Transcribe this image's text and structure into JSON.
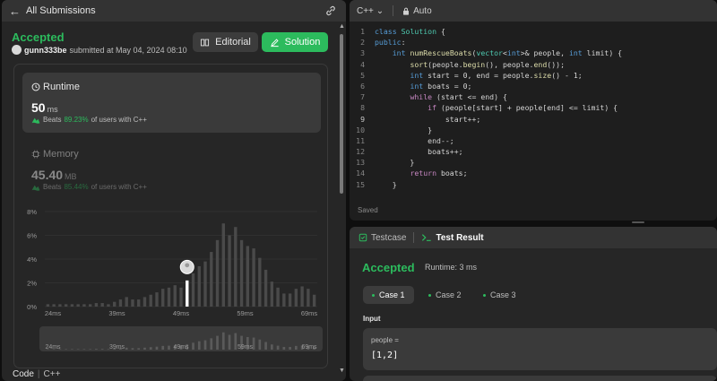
{
  "submission": {
    "back_label": "All Submissions",
    "status": "Accepted",
    "user": "gunn333be",
    "submitted_text": "submitted at May 04, 2024 08:10",
    "editorial_label": "Editorial",
    "solution_label": "Solution"
  },
  "runtime": {
    "title": "Runtime",
    "value": "50",
    "unit": "ms",
    "beats_prefix": "Beats",
    "beats_pct": "89.23%",
    "beats_suffix": "of users with C++"
  },
  "memory": {
    "title": "Memory",
    "value": "45.40",
    "unit": "MB",
    "beats_prefix": "Beats",
    "beats_pct": "85.44%",
    "beats_suffix": "of users with C++"
  },
  "chart_data": {
    "type": "bar",
    "yticks": [
      "8%",
      "6%",
      "4%",
      "2%",
      "0%"
    ],
    "ylim": [
      0,
      8
    ],
    "xticks": [
      "24ms",
      "39ms",
      "49ms",
      "59ms",
      "69ms"
    ],
    "mini_xticks": [
      "24ms",
      "39ms",
      "49ms",
      "59ms",
      "69ms"
    ],
    "values": [
      0.2,
      0.2,
      0.2,
      0.2,
      0.2,
      0.2,
      0.2,
      0.2,
      0.3,
      0.3,
      0.2,
      0.4,
      0.6,
      0.8,
      0.6,
      0.6,
      0.8,
      1.0,
      1.2,
      1.5,
      1.6,
      1.8,
      1.6,
      2.2,
      2.8,
      3.4,
      3.8,
      4.6,
      5.6,
      7.0,
      6.0,
      6.7,
      5.6,
      5.1,
      4.9,
      4.1,
      3.1,
      2.1,
      1.6,
      1.1,
      1.1,
      1.5,
      1.7,
      1.5,
      1.0
    ],
    "highlight_index": 23
  },
  "footer": {
    "code_label": "Code",
    "language": "C++"
  },
  "editor": {
    "language": "C++",
    "mode": "Auto",
    "saved_label": "Saved",
    "lines": [
      "1",
      "2",
      "3",
      "4",
      "5",
      "6",
      "7",
      "8",
      "9",
      "10",
      "11",
      "12",
      "13",
      "14",
      "15"
    ]
  },
  "result": {
    "testcase_tab": "Testcase",
    "result_tab": "Test Result",
    "status": "Accepted",
    "runtime_text": "Runtime: 3 ms",
    "cases": [
      "Case 1",
      "Case 2",
      "Case 3"
    ],
    "input_label": "Input",
    "param_name": "people =",
    "param_value": "[1,2]"
  },
  "colors": {
    "accent": "#2cbb5d",
    "panel": "#262626",
    "editor_bg": "#1e1e1e"
  },
  "icons": [
    "arrow-left-icon",
    "link-icon",
    "book-icon",
    "edit-icon",
    "clock-icon",
    "chip-icon",
    "leaf-icon",
    "lock-icon",
    "check-box-icon",
    "terminal-icon"
  ]
}
